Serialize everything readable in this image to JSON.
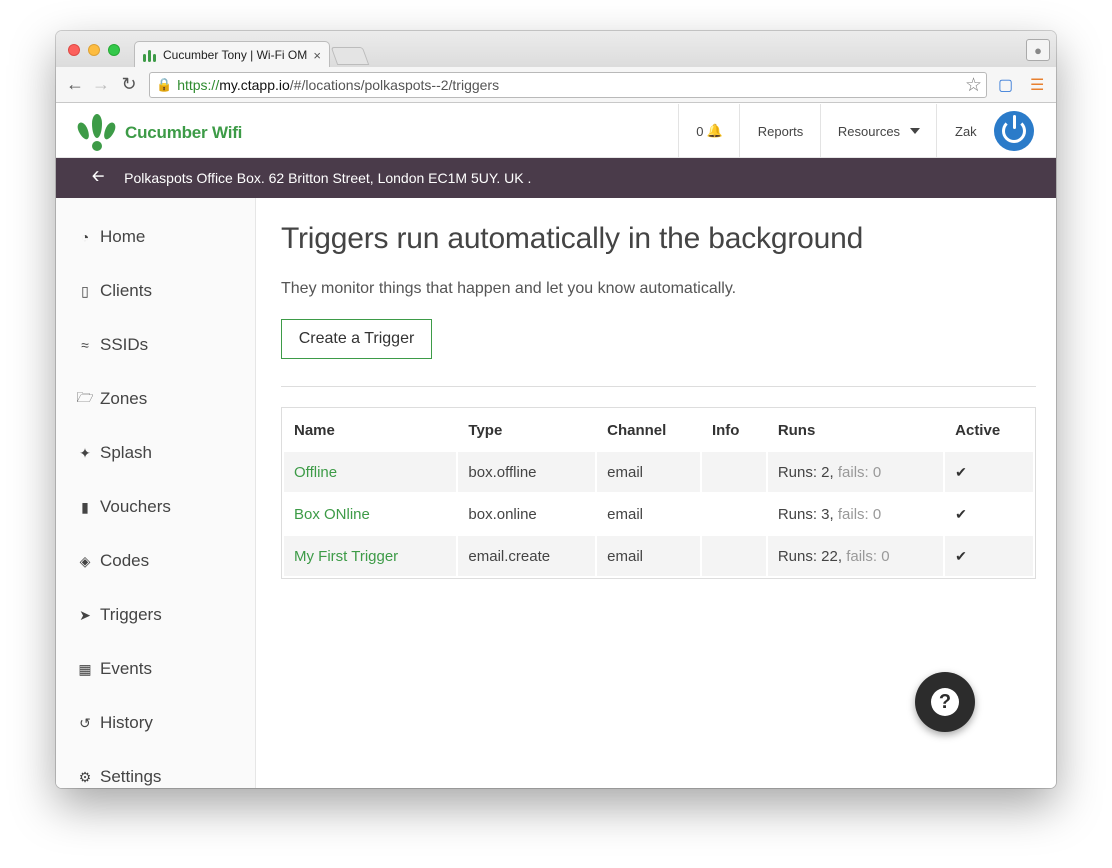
{
  "browser": {
    "tab_title": "Cucumber Tony | Wi-Fi OM",
    "tab_close": "×",
    "url_scheme": "https://",
    "url_host": "my.ctapp.io",
    "url_path": "/#/locations/polkaspots--2/triggers"
  },
  "topnav": {
    "brand": "Cucumber Wifi",
    "notifications_count": "0",
    "reports": "Reports",
    "resources": "Resources",
    "user": "Zak"
  },
  "location_bar": {
    "text": "Polkaspots Office Box. 62 Britton Street, London EC1M 5UY. UK ."
  },
  "sidebar": {
    "items": [
      {
        "label": "Home",
        "icon": "dashboard-icon"
      },
      {
        "label": "Clients",
        "icon": "mobile-icon"
      },
      {
        "label": "SSIDs",
        "icon": "wifi-icon"
      },
      {
        "label": "Zones",
        "icon": "folder-icon"
      },
      {
        "label": "Splash",
        "icon": "magic-wand-icon"
      },
      {
        "label": "Vouchers",
        "icon": "book-icon"
      },
      {
        "label": "Codes",
        "icon": "tag-icon"
      },
      {
        "label": "Triggers",
        "icon": "rocket-icon"
      },
      {
        "label": "Events",
        "icon": "calendar-icon"
      },
      {
        "label": "History",
        "icon": "history-icon"
      },
      {
        "label": "Settings",
        "icon": "cogs-icon"
      }
    ]
  },
  "main": {
    "title": "Triggers run automatically in the background",
    "subtitle": "They monitor things that happen and let you know automatically.",
    "create_button": "Create a Trigger",
    "table": {
      "headers": [
        "Name",
        "Type",
        "Channel",
        "Info",
        "Runs",
        "Active"
      ],
      "rows": [
        {
          "name": "Offline",
          "type": "box.offline",
          "channel": "email",
          "info": "",
          "runs": "Runs: 2,",
          "fails": "fails: 0",
          "active": true
        },
        {
          "name": "Box ONline",
          "type": "box.online",
          "channel": "email",
          "info": "",
          "runs": "Runs: 3,",
          "fails": "fails: 0",
          "active": true
        },
        {
          "name": "My First Trigger",
          "type": "email.create",
          "channel": "email",
          "info": "",
          "runs": "Runs: 22,",
          "fails": "fails: 0",
          "active": true
        }
      ]
    }
  },
  "help_button": "?"
}
